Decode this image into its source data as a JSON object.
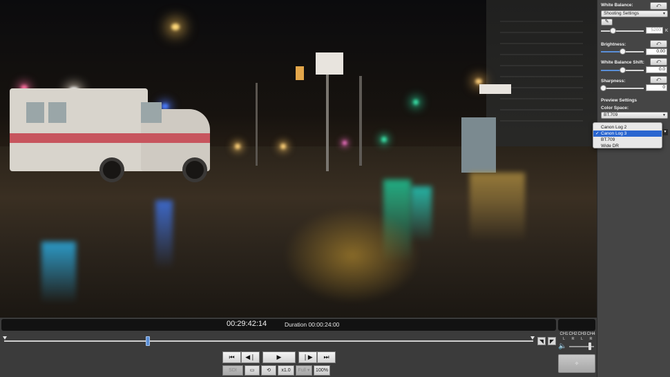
{
  "player": {
    "timecode": "00:29:42:14",
    "duration": "Duration 00:00:24:00",
    "playhead_position": 0.27
  },
  "transport": {
    "go_start_icon": "skip-to-start-icon",
    "prev_frame_icon": "previous-frame-icon",
    "play_icon": "play-icon",
    "next_frame_icon": "next-frame-icon",
    "go_end_icon": "skip-to-end-icon"
  },
  "bottom_controls": {
    "sdi_out": "SDI OUT",
    "speed": "x1.0 ▾",
    "fit": "Full ▾",
    "zoom": "100%"
  },
  "audio": {
    "channels": [
      {
        "label": "CH1",
        "lr": "L"
      },
      {
        "label": "CH2",
        "lr": "R"
      },
      {
        "label": "CH3",
        "lr": "L"
      },
      {
        "label": "CH4",
        "lr": "R"
      }
    ]
  },
  "panel": {
    "white_balance_label": "White Balance:",
    "white_balance_mode": "Shooting Settings",
    "kelvin_value": "5200",
    "kelvin_unit": "K",
    "brightness_label": "Brightness:",
    "brightness_value": "0.00",
    "brightness_level": 0.5,
    "wb_shift_label": "White Balance Shift:",
    "wb_shift_value": "0.0",
    "wb_shift_level": 0.5,
    "sharpness_label": "Sharpness:",
    "sharpness_value": "0",
    "sharpness_level": 0.0,
    "preview_settings_label": "Preview Settings",
    "color_space_label": "Color Space:",
    "color_space_value": "BT.709"
  },
  "color_space_menu": {
    "options": [
      "Canon Log 2",
      "Canon Log 3",
      "BT.709",
      "Wide DR"
    ],
    "selected": "Canon Log 3"
  }
}
